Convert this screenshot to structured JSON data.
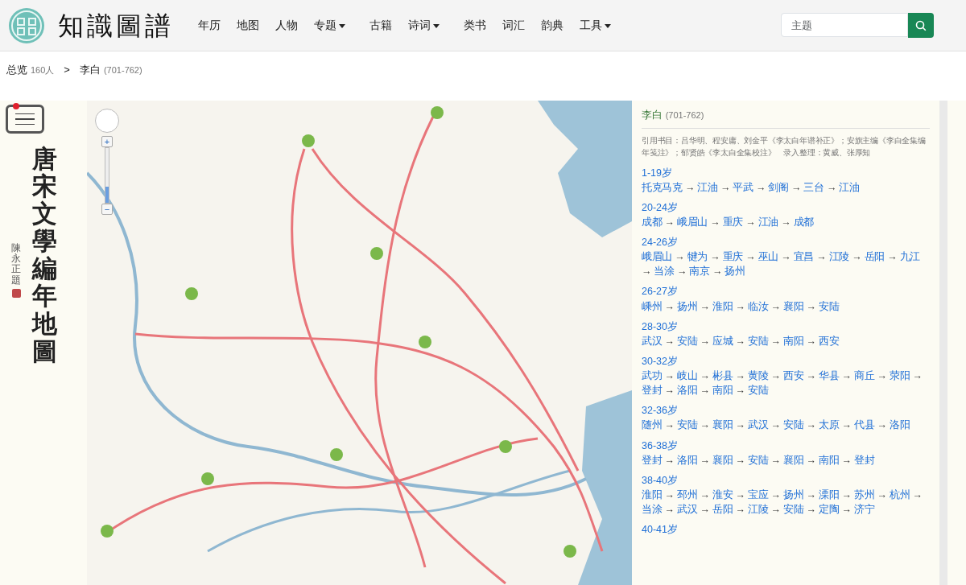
{
  "brand": {
    "name": "知識圖譜"
  },
  "nav": [
    {
      "label": "年历",
      "dropdown": false
    },
    {
      "label": "地图",
      "dropdown": false
    },
    {
      "label": "人物",
      "dropdown": false
    },
    {
      "label": "专题",
      "dropdown": true
    },
    {
      "label": "古籍",
      "dropdown": false
    },
    {
      "label": "诗词",
      "dropdown": true
    },
    {
      "label": "类书",
      "dropdown": false
    },
    {
      "label": "词汇",
      "dropdown": false
    },
    {
      "label": "韵典",
      "dropdown": false
    },
    {
      "label": "工具",
      "dropdown": true
    }
  ],
  "search": {
    "placeholder": "主题"
  },
  "breadcrumb": {
    "root": "总览",
    "count": "160人",
    "separator": ">",
    "current": "李白",
    "years": "(701-762)"
  },
  "sidebar": {
    "title": "唐宋文學編年地圖",
    "signature": "陳永正題",
    "menu_badge": true
  },
  "map": {
    "kind": "picture",
    "zoom_in": "+",
    "zoom_out": "−",
    "zoom_level": {
      "level": 0.3
    }
  },
  "panel": {
    "name": "李白",
    "years": "(701-762)",
    "sources": "引用书目：吕华明、程安庸、刘金平《李太白年谱补正》；安旗主编《李白全集编年笺注》；郁贤皓《李太白全集校注》　录入整理：黄威、张厚知",
    "separator": "→",
    "segments": [
      {
        "age": "1-19岁",
        "places": [
          "托克马克",
          "江油",
          "平武",
          "剑阁",
          "三台",
          "江油"
        ]
      },
      {
        "age": "20-24岁",
        "places": [
          "成都",
          "峨眉山",
          "重庆",
          "江油",
          "成都"
        ]
      },
      {
        "age": "24-26岁",
        "places": [
          "峨眉山",
          "犍为",
          "重庆",
          "巫山",
          "宜昌",
          "江陵",
          "岳阳",
          "九江",
          "当涂",
          "南京",
          "扬州"
        ]
      },
      {
        "age": "26-27岁",
        "places": [
          "嵊州",
          "扬州",
          "淮阳",
          "临汝",
          "襄阳",
          "安陆"
        ]
      },
      {
        "age": "28-30岁",
        "places": [
          "武汉",
          "安陆",
          "应城",
          "安陆",
          "南阳",
          "西安"
        ]
      },
      {
        "age": "30-32岁",
        "places": [
          "武功",
          "岐山",
          "彬县",
          "黄陵",
          "西安",
          "华县",
          "商丘",
          "荥阳",
          "登封",
          "洛阳",
          "南阳",
          "安陆"
        ]
      },
      {
        "age": "32-36岁",
        "places": [
          "随州",
          "安陆",
          "襄阳",
          "武汉",
          "安陆",
          "太原",
          "代县",
          "洛阳"
        ]
      },
      {
        "age": "36-38岁",
        "places": [
          "登封",
          "洛阳",
          "襄阳",
          "安陆",
          "襄阳",
          "南阳",
          "登封"
        ]
      },
      {
        "age": "38-40岁",
        "places": [
          "淮阳",
          "邳州",
          "淮安",
          "宝应",
          "扬州",
          "溧阳",
          "苏州",
          "杭州",
          "当涂",
          "武汉",
          "岳阳",
          "江陵",
          "安陆",
          "定陶",
          "济宁"
        ]
      },
      {
        "age": "40-41岁"
      }
    ]
  }
}
